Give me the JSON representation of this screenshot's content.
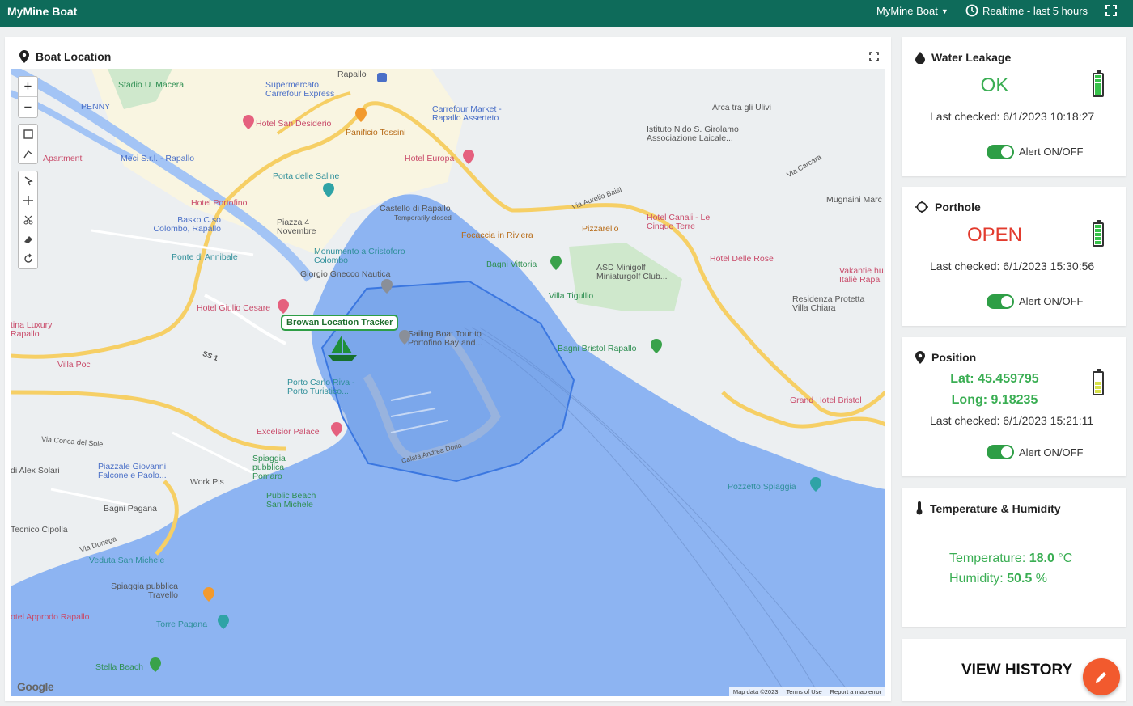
{
  "app": {
    "title": "MyMine Boat",
    "dashboard_select": "MyMine Boat",
    "timewindow": "Realtime - last 5 hours"
  },
  "map_card": {
    "title": "Boat Location",
    "tracker_label": "Browan Location Tracker",
    "labels": [
      "Rapallo",
      "Stadio U. Macera",
      "Supermercato Carrefour Express",
      "PENNY",
      "Hotel San Desiderio",
      "Panificio Tossini",
      "Carrefour Market - Rapallo Asserteto",
      "Arca tra gli Ulivi",
      "Istituto Nido S. Girolamo Associazione Laicale...",
      "Apartment",
      "Meci S.r.l. - Rapallo",
      "Hotel Europa",
      "Porta delle Saline",
      "Via Carcara",
      "Hotel Portofino",
      "Castello di Rapallo",
      "Temporarily closed",
      "Via Aurelio Baisi",
      "Mugnaini Marc",
      "Basko C.so Colombo, Rapallo",
      "Piazza 4 Novembre",
      "Focaccia in Riviera",
      "Pizzarello",
      "Hotel Canali - Le Cinque Terre",
      "Ponte di Annibale",
      "Monumento a Cristoforo Colombo",
      "Bagni Vittoria",
      "ASD Minigolf Miniaturgolf Club...",
      "Hotel Delle Rose",
      "Giorgio Gnecco Nautica",
      "Vakantie hu Italiè Rapa",
      "Villa Tigullio",
      "Residenza Protetta Villa Chiara",
      "Hotel Giulio Cesare",
      "Sailing Boat Tour to Portofino Bay and...",
      "tina Luxury Rapallo",
      "Bagni Bristol Rapallo",
      "Villa Poc",
      "Porto Carlo Riva - Porto Turistico...",
      "Grand Hotel Bristol",
      "Excelsior Palace",
      "Via Conca del Sole",
      "Calata Andrea Doria",
      "di Alex Solari",
      "Piazzale Giovanni Falcone e Paolo...",
      "Spiaggia pubblica Pomaro",
      "Work Pls",
      "Public Beach San Michele",
      "Pozzetto Spiaggia",
      "Tecnico Cipolla",
      "Bagni Pagana",
      "Veduta San Michele",
      "Spiaggia pubblica Travello",
      "otel Approdo Rapallo",
      "Torre Pagana",
      "Stella Beach",
      "Via Donega",
      "SS 1"
    ],
    "attribution": [
      "Map data ©2023",
      "Terms of Use",
      "Report a map error"
    ],
    "google": "Google"
  },
  "water": {
    "title": "Water Leakage",
    "status": "OK",
    "status_color": "#3aae53",
    "checked": "Last checked: 6/1/2023 10:18:27",
    "alert_label": "Alert ON/OFF",
    "alert_on": true,
    "battery_level": 1.0
  },
  "porthole": {
    "title": "Porthole",
    "status": "OPEN",
    "status_color": "#e23b2e",
    "checked": "Last checked: 6/1/2023 15:30:56",
    "alert_label": "Alert ON/OFF",
    "alert_on": true,
    "battery_level": 1.0
  },
  "position": {
    "title": "Position",
    "lat_label": "Lat:",
    "lat": "45.459795",
    "long_label": "Long:",
    "long": "9.18235",
    "checked": "Last checked: 6/1/2023 15:21:11",
    "alert_label": "Alert ON/OFF",
    "alert_on": true,
    "battery_level": 0.6
  },
  "climate": {
    "title": "Temperature & Humidity",
    "temp_label": "Temperature:",
    "temp_value": "18.0",
    "temp_unit": "°C",
    "hum_label": "Humidity:",
    "hum_value": "50.5",
    "hum_unit": "%"
  },
  "history": {
    "label": "VIEW HISTORY"
  },
  "colors": {
    "header": "#0e6b5a",
    "accent": "#3aae53",
    "alert": "#e23b2e",
    "fab": "#f25a2e"
  }
}
